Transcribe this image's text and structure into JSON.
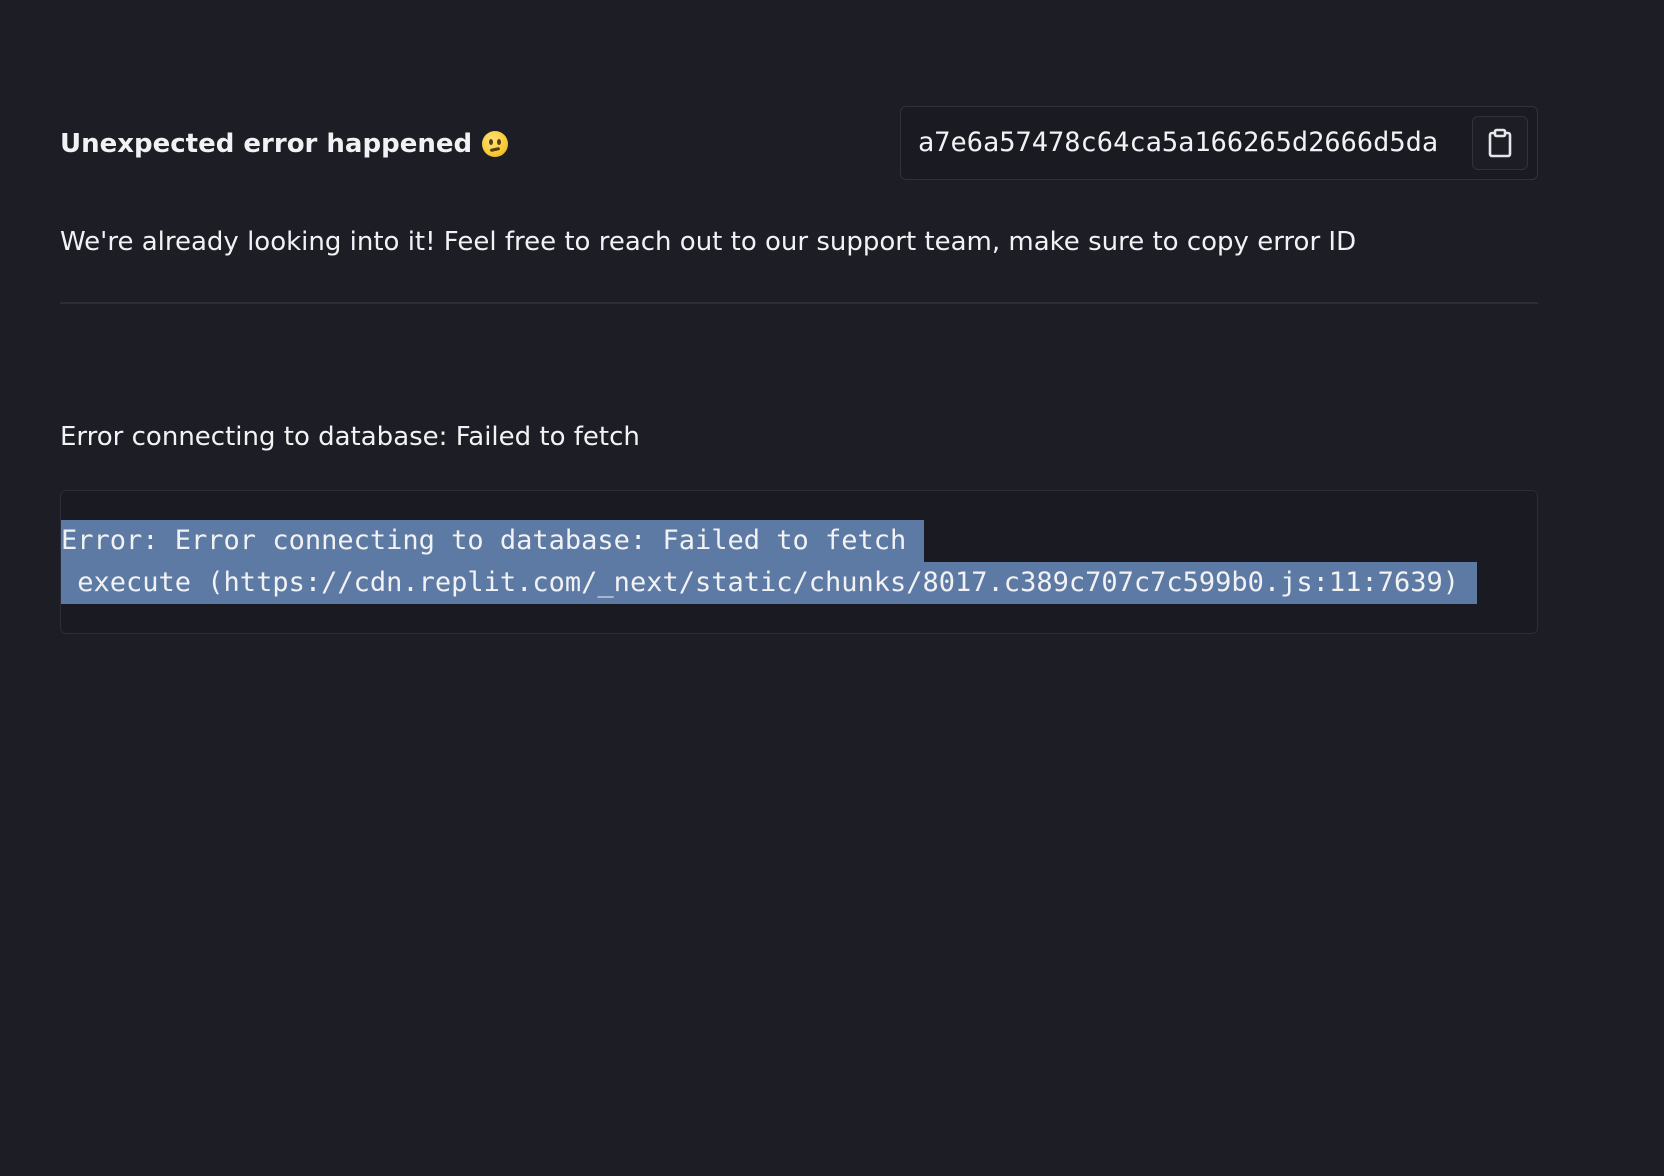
{
  "header": {
    "title": "Unexpected error happened",
    "emoji_icon": "confused-face-icon"
  },
  "error_id": {
    "value": "a7e6a57478c64ca5a166265d2666d5da",
    "copy_icon": "clipboard-icon"
  },
  "message": "We're already looking into it! Feel free to reach out to our support team, make sure to copy error ID",
  "error_summary": "Error connecting to database: Failed to fetch",
  "stack_trace": {
    "lines": [
      "Error: Error connecting to database: Failed to fetch",
      " execute (https://cdn.replit.com/_next/static/chunks/8017.c389c707c7c599b0.js:11:7639)"
    ],
    "selection_color": "#5c7aa3"
  },
  "colors": {
    "background": "#1c1d25",
    "text": "#f2f2f4",
    "border": "#30323d"
  }
}
